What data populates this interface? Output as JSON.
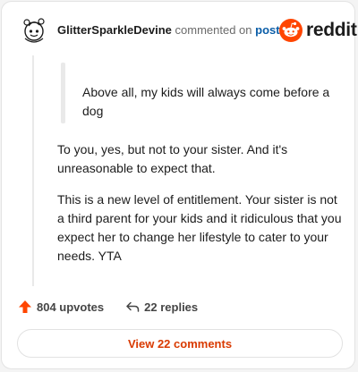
{
  "comment": {
    "username": "GlitterSparkleDevine",
    "action_text": "commented on",
    "target_text": "post",
    "quote": "Above all, my kids will always come before a dog",
    "paragraphs": [
      "To you, yes, but not to your sister. And it's unreasonable to expect that.",
      "This is a new level of entitlement. Your sister is not a third parent for your kids and it ridiculous that you expect her to change her lifestyle to cater to your needs. YTA"
    ]
  },
  "brand": {
    "name": "reddit",
    "color": "#ff4500"
  },
  "stats": {
    "upvotes": "804 upvotes",
    "replies": "22 replies"
  },
  "footer": {
    "view_comments": "View 22 comments"
  },
  "colors": {
    "upvote": "#ff4500",
    "link": "#0b5ea8",
    "view_button": "#d93a00"
  },
  "icons": [
    "snoo-avatar-icon",
    "reddit-logo-icon",
    "upvote-arrow-icon",
    "reply-arrow-icon"
  ]
}
